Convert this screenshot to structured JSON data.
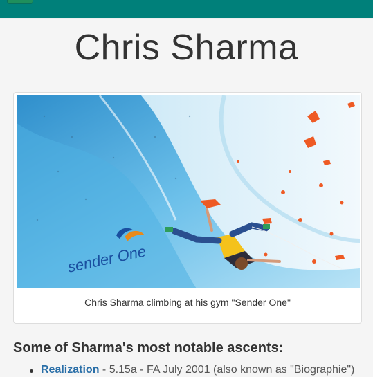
{
  "header": {
    "menu_icon": "hamburger-icon",
    "bar_color": "#00807a"
  },
  "page": {
    "title": "Chris Sharma"
  },
  "figure": {
    "image_subject": "climber-photo",
    "caption": "Chris Sharma climbing at his gym \"Sender One\"",
    "wall_logo": "sender One"
  },
  "ascents": {
    "heading": "Some of Sharma's most notable ascents:",
    "items": [
      {
        "name": "Realization",
        "details": " - 5.15a - FA July 2001 (also known as \"Biographie\")"
      }
    ]
  },
  "colors": {
    "link": "#2a6fa8",
    "accent": "#00807a"
  }
}
